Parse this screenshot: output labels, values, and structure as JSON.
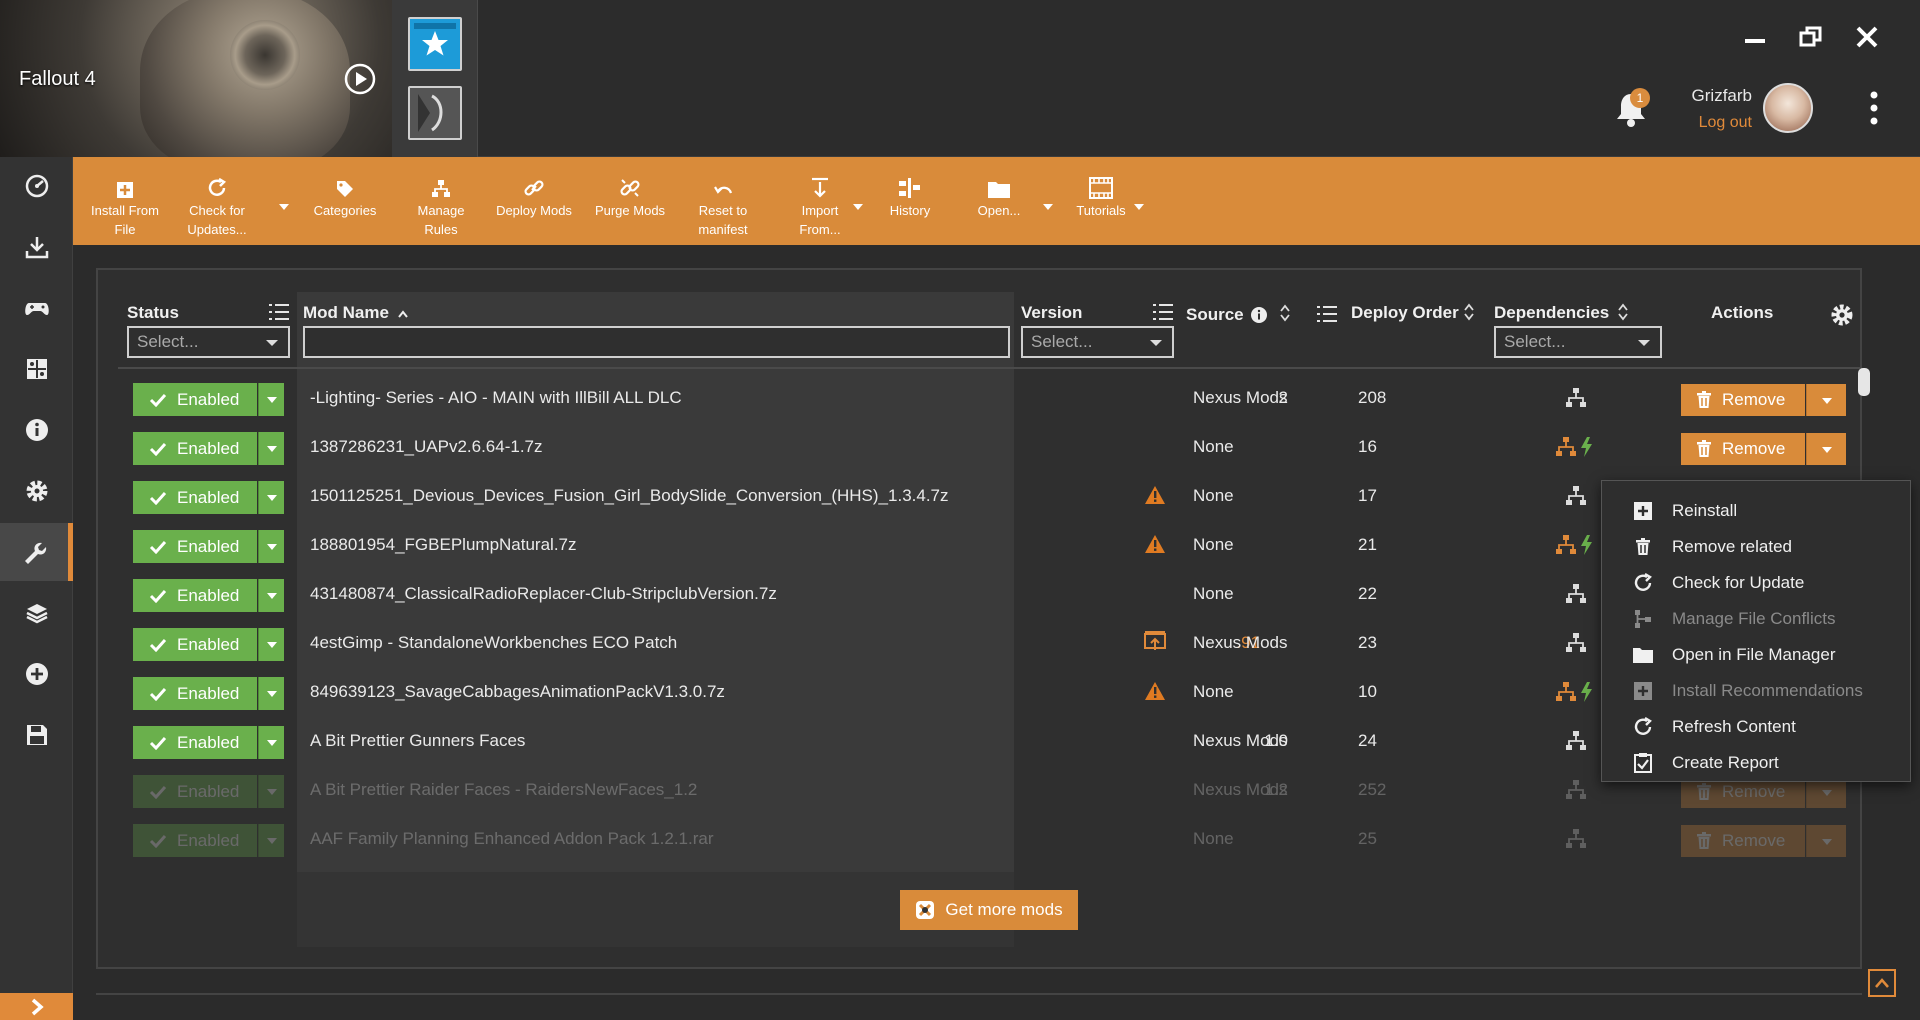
{
  "game": {
    "title": "Fallout 4"
  },
  "user": {
    "name": "Grizfarb",
    "logout_label": "Log out",
    "notification_count": "1"
  },
  "toolbar": {
    "install_from_file": "Install From File",
    "check_for_updates": "Check for Updates...",
    "categories": "Categories",
    "manage_rules": "Manage Rules",
    "deploy_mods": "Deploy Mods",
    "purge_mods": "Purge Mods",
    "reset_to_manifest": "Reset to manifest",
    "import_from": "Import From...",
    "history": "History",
    "open": "Open...",
    "tutorials": "Tutorials"
  },
  "table": {
    "headers": {
      "status": "Status",
      "mod_name": "Mod Name",
      "version": "Version",
      "source": "Source",
      "deploy_order": "Deploy Order",
      "dependencies": "Dependencies",
      "actions": "Actions"
    },
    "filters": {
      "status_placeholder": "Select...",
      "version_placeholder": "Select...",
      "dependencies_placeholder": "Select..."
    },
    "sort": {
      "column": "Mod Name",
      "direction": "ascending"
    },
    "enabled_label": "Enabled",
    "remove_label": "Remove",
    "rows": [
      {
        "name": "-Lighting- Series - AIO - MAIN with IllBill ALL DLC",
        "version": "2",
        "source": "Nexus Mods",
        "deploy_order": "208"
      },
      {
        "name": "1387286231_UAPv2.6.64-1.7z",
        "version": "",
        "source": "None",
        "deploy_order": "16"
      },
      {
        "name": "1501125251_Devious_Devices_Fusion_Girl_BodySlide_Conversion_(HHS)_1.3.4.7z",
        "version": "",
        "source": "None",
        "deploy_order": "17"
      },
      {
        "name": "188801954_FGBEPlumpNatural.7z",
        "version": "",
        "source": "None",
        "deploy_order": "21"
      },
      {
        "name": "431480874_ClassicalRadioReplacer-Club-StripclubVersion.7z",
        "version": "",
        "source": "None",
        "deploy_order": "22"
      },
      {
        "name": "4estGimp - StandaloneWorkbenches ECO Patch",
        "version": ".91",
        "source": "Nexus Mods",
        "deploy_order": "23"
      },
      {
        "name": "849639123_SavageCabbagesAnimationPackV1.3.0.7z",
        "version": "",
        "source": "None",
        "deploy_order": "10"
      },
      {
        "name": "A Bit Prettier Gunners Faces",
        "version": "1.0",
        "source": "Nexus Mods",
        "deploy_order": "24"
      },
      {
        "name": "A Bit Prettier Raider Faces - RaidersNewFaces_1.2",
        "version": "1.2",
        "source": "Nexus Mods",
        "deploy_order": "252"
      },
      {
        "name": "AAF Family Planning Enhanced Addon Pack 1.2.1.rar",
        "version": "",
        "source": "None",
        "deploy_order": "25"
      }
    ]
  },
  "get_more_mods": "Get more mods",
  "context_menu": {
    "items": [
      {
        "label": "Reinstall",
        "icon": "plus-square-icon",
        "enabled": true
      },
      {
        "label": "Remove related",
        "icon": "trash-icon",
        "enabled": true
      },
      {
        "label": "Check for Update",
        "icon": "refresh-icon",
        "enabled": true
      },
      {
        "label": "Manage File Conflicts",
        "icon": "conflict-icon",
        "enabled": false
      },
      {
        "label": "Open in File Manager",
        "icon": "folder-icon",
        "enabled": true
      },
      {
        "label": "Install Recommendations",
        "icon": "plus-square-icon",
        "enabled": false
      },
      {
        "label": "Refresh Content",
        "icon": "refresh-icon",
        "enabled": true
      },
      {
        "label": "Create Report",
        "icon": "clipboard-icon",
        "enabled": true
      }
    ]
  },
  "colors": {
    "accent": "#d98b3a",
    "enabled": "#6ab04c",
    "background": "#2b2b2b"
  }
}
